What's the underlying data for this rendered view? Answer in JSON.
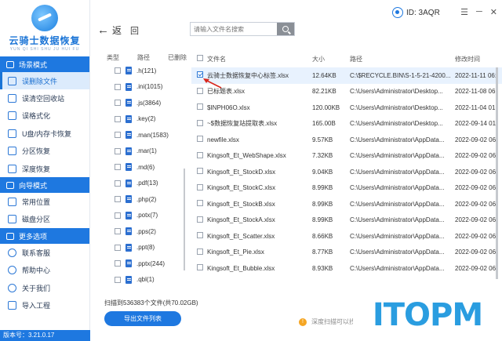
{
  "app": {
    "title": "云骑士数据恢复",
    "subtitle": "YUN QI SHI SHU JU HUI FU",
    "user_id": "ID: 3AQR",
    "version": "版本号：3.21.0.17"
  },
  "window_controls": {
    "menu": "☰",
    "minimize": "─",
    "close": "✕"
  },
  "sidebar": {
    "sections": [
      {
        "title": "场景模式",
        "items": [
          "误删除文件",
          "误清空回收站",
          "误格式化",
          "U盘/内存卡恢复",
          "分区恢复",
          "深度恢复"
        ]
      },
      {
        "title": "向导模式",
        "items": [
          "常用位置",
          "磁盘分区"
        ]
      },
      {
        "title": "更多选项",
        "items": [
          "联系客服",
          "帮助中心",
          "关于我们",
          "导入工程"
        ]
      }
    ]
  },
  "toolbar": {
    "back_label": "返",
    "refresh_label": "回",
    "search_placeholder": "请输入文件名搜索"
  },
  "tree": {
    "tabs": [
      "类型",
      "路径",
      "已删除"
    ],
    "items": [
      ".h(121)",
      ".ini(1015)",
      ".js(3864)",
      ".key(2)",
      ".man(1583)",
      ".mar(1)",
      ".md(6)",
      ".pdf(13)",
      ".php(2)",
      ".potx(7)",
      ".pps(2)",
      ".ppt(8)",
      ".pptx(244)",
      ".qbl(1)"
    ]
  },
  "table": {
    "columns": [
      "文件名",
      "大小",
      "路径",
      "修改时间"
    ],
    "rows": [
      {
        "name": "云骑士数据恢复中心标签.xlsx",
        "size": "12.64KB",
        "path": "C:\\$RECYCLE.BIN\\S-1-5-21-4200...",
        "date": "2022-11-11 06:",
        "checked": true
      },
      {
        "name": "已标题表.xlsx",
        "size": "82.21KB",
        "path": "C:\\Users\\Administrator\\Desktop...",
        "date": "2022-11-08 06:",
        "checked": false
      },
      {
        "name": "$INPH06O.xlsx",
        "size": "120.00KB",
        "path": "C:\\Users\\Administrator\\Desktop...",
        "date": "2022-11-04 01:",
        "checked": false
      },
      {
        "name": "~$数据恢复站提取表.xlsx",
        "size": "165.00B",
        "path": "C:\\Users\\Administrator\\Desktop...",
        "date": "2022-09-14 01:",
        "checked": false
      },
      {
        "name": "newfile.xlsx",
        "size": "9.57KB",
        "path": "C:\\Users\\Administrator\\AppData...",
        "date": "2022-09-02 06:",
        "checked": false
      },
      {
        "name": "Kingsoft_Et_WebShape.xlsx",
        "size": "7.32KB",
        "path": "C:\\Users\\Administrator\\AppData...",
        "date": "2022-09-02 06:",
        "checked": false
      },
      {
        "name": "Kingsoft_Et_StockD.xlsx",
        "size": "9.04KB",
        "path": "C:\\Users\\Administrator\\AppData...",
        "date": "2022-09-02 06:",
        "checked": false
      },
      {
        "name": "Kingsoft_Et_StockC.xlsx",
        "size": "8.99KB",
        "path": "C:\\Users\\Administrator\\AppData...",
        "date": "2022-09-02 06:",
        "checked": false
      },
      {
        "name": "Kingsoft_Et_StockB.xlsx",
        "size": "8.99KB",
        "path": "C:\\Users\\Administrator\\AppData...",
        "date": "2022-09-02 06:",
        "checked": false
      },
      {
        "name": "Kingsoft_Et_StockA.xlsx",
        "size": "8.99KB",
        "path": "C:\\Users\\Administrator\\AppData...",
        "date": "2022-09-02 06:",
        "checked": false
      },
      {
        "name": "Kingsoft_Et_Scatter.xlsx",
        "size": "8.66KB",
        "path": "C:\\Users\\Administrator\\AppData...",
        "date": "2022-09-02 06:",
        "checked": false
      },
      {
        "name": "Kingsoft_Et_Pie.xlsx",
        "size": "8.77KB",
        "path": "C:\\Users\\Administrator\\AppData...",
        "date": "2022-09-02 06:",
        "checked": false
      },
      {
        "name": "Kingsoft_Et_Bubble.xlsx",
        "size": "8.93KB",
        "path": "C:\\Users\\Administrator\\AppData...",
        "date": "2022-09-02 06:",
        "checked": false
      }
    ]
  },
  "footer": {
    "status": "扫描到536383个文件(共70.02GB)",
    "export_label": "导出文件列表",
    "deep_scan_hint": "深度扫描可以找"
  },
  "watermark": "ITOPM"
}
